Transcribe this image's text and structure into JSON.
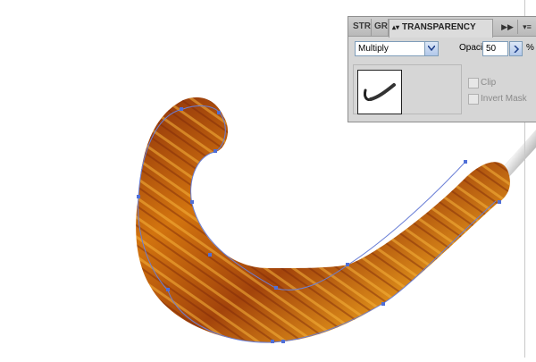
{
  "panel": {
    "tabs": [
      {
        "label": "STR"
      },
      {
        "label": "GRA"
      },
      {
        "label": "TRANSPARENCY",
        "active": true
      }
    ],
    "blend_mode": "Multiply",
    "opacity_label": "Opacity:",
    "opacity_value": "50",
    "opacity_unit": "%",
    "clip_label": "Clip",
    "invert_mask_label": "Invert Mask",
    "clip_checked": false,
    "invert_mask_checked": false
  },
  "icons": {
    "tab_arrows": "up-down-arrows-icon",
    "collapse": "double-right-arrow-icon",
    "menu": "panel-menu-icon",
    "blend_dropdown": "chevron-down-icon",
    "opacity_dropdown": "chevron-right-icon"
  },
  "colors": {
    "path_outline": "#6a7fd6",
    "brush_dark": "#8a2e0a",
    "brush_mid": "#c8680e",
    "brush_light": "#f0a020",
    "panel_bg": "#d6d6d6"
  }
}
